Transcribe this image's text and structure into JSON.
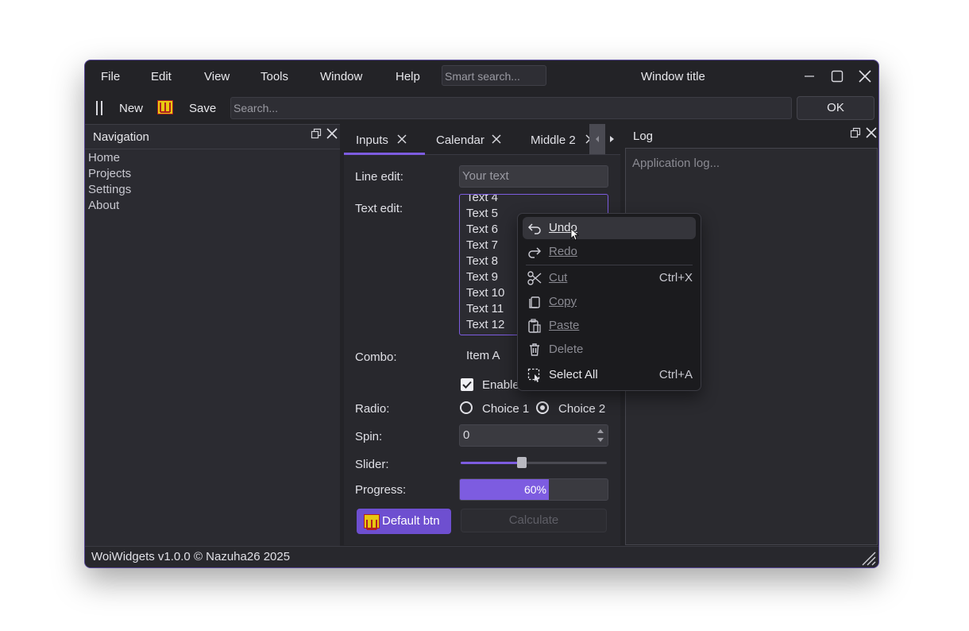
{
  "menu": {
    "items": [
      {
        "label": "File"
      },
      {
        "label": "Edit"
      },
      {
        "label": "View"
      },
      {
        "label": "Tools"
      },
      {
        "label": "Window"
      },
      {
        "label": "Help"
      }
    ],
    "smart_search_placeholder": "Smart search..."
  },
  "window": {
    "title": "Window title"
  },
  "toolbar": {
    "new_label": "New",
    "save_label": "Save",
    "search_placeholder": "Search...",
    "ok_label": "OK"
  },
  "navigation": {
    "title": "Navigation",
    "items": [
      "Home",
      "Projects",
      "Settings",
      "About"
    ]
  },
  "tabs": [
    {
      "label": "Inputs",
      "active": true
    },
    {
      "label": "Calendar",
      "active": false
    },
    {
      "label": "Middle 2",
      "active": false
    }
  ],
  "form": {
    "line_edit_label": "Line edit:",
    "line_edit_placeholder": "Your text",
    "text_edit_label": "Text edit:",
    "text_edit_lines": [
      "Text 4",
      "Text 5",
      "Text 6",
      "Text 7",
      "Text 8",
      "Text 9",
      "Text 10",
      "Text 11",
      "Text 12"
    ],
    "combo_label": "Combo:",
    "combo_value": "Item A",
    "checkbox_label": "Enable",
    "checkbox_checked": true,
    "radio_label": "Radio:",
    "radio_options": [
      "Choice 1",
      "Choice 2"
    ],
    "radio_selected": "Choice 2",
    "spin_label": "Spin:",
    "spin_value": "0",
    "slider_label": "Slider:",
    "slider_value": 0.42,
    "progress_label": "Progress:",
    "progress_value": 60,
    "progress_text": "60%",
    "default_btn_label": "Default btn",
    "calculate_label": "Calculate"
  },
  "log": {
    "title": "Log",
    "placeholder": "Application log..."
  },
  "context_menu": {
    "items": [
      {
        "label": "Undo",
        "shortcut": "",
        "enabled": true,
        "icon": "undo-icon"
      },
      {
        "label": "Redo",
        "shortcut": "",
        "enabled": false,
        "icon": "redo-icon"
      },
      {
        "label": "Cut",
        "shortcut": "Ctrl+X",
        "enabled": false,
        "icon": "scissors-icon"
      },
      {
        "label": "Copy",
        "shortcut": "",
        "enabled": false,
        "icon": "copy-icon"
      },
      {
        "label": "Paste",
        "shortcut": "",
        "enabled": false,
        "icon": "paste-icon"
      },
      {
        "label": "Delete",
        "shortcut": "",
        "enabled": false,
        "icon": "trash-icon"
      },
      {
        "label": "Select All",
        "shortcut": "Ctrl+A",
        "enabled": true,
        "icon": "select-all-icon"
      }
    ]
  },
  "status": {
    "text": "WoiWidgets v1.0.0 © Nazuha26 2025"
  },
  "colors": {
    "accent": "#7d5ce0",
    "background": "#232327",
    "logo_yellow": "#e8c810",
    "logo_red": "#b02020"
  }
}
